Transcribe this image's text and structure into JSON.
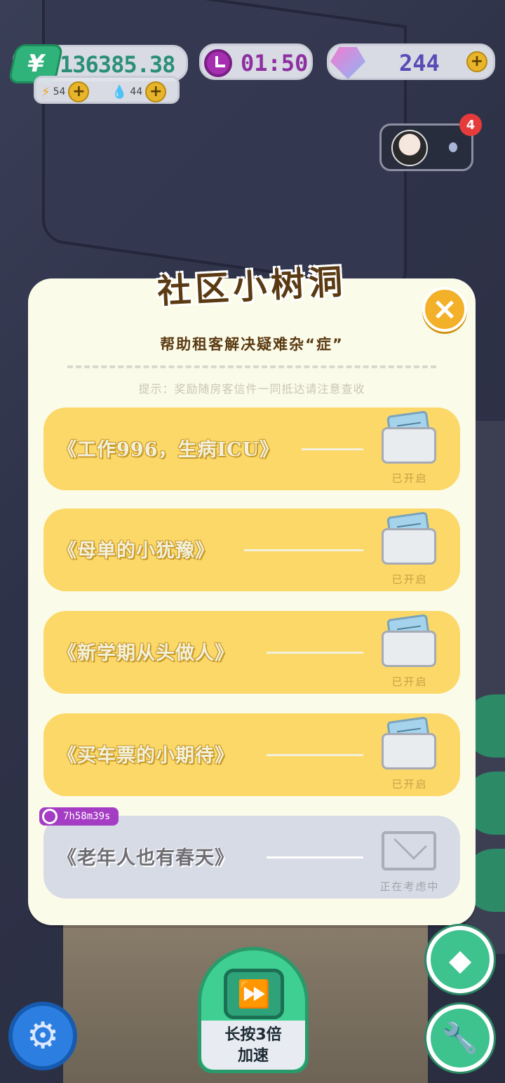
{
  "hud": {
    "money": "136385.38",
    "money_symbol": "¥",
    "energy": "54",
    "water": "44",
    "timer": "01:50",
    "gems": "244",
    "notification_count": "4"
  },
  "dialog": {
    "title": "社区小树洞",
    "close_label": "×",
    "subtitle": "帮助租客解决疑难杂“症”",
    "hint": "提示：奖励随房客信件一同抵达请注意查收",
    "letters": [
      {
        "title": "《工作996，生病ICU》",
        "status": "已开启"
      },
      {
        "title": "《母单的小犹豫》",
        "status": "已开启"
      },
      {
        "title": "《新学期从头做人》",
        "status": "已开启"
      },
      {
        "title": "《买车票的小期待》",
        "status": "已开启"
      },
      {
        "title": "《老年人也有春天》",
        "status": "正在考虑中",
        "countdown": "7h58m39s"
      }
    ]
  },
  "bottom": {
    "speed_label_line1": "长按3倍",
    "speed_label_line2": "加速"
  },
  "colors": {
    "letter_open": "#fbd868",
    "letter_locked": "#d7dbe5",
    "dialog_bg": "#fbfbe9",
    "accent_orange": "#f3b12a",
    "countdown_purple": "#a53cc4"
  }
}
